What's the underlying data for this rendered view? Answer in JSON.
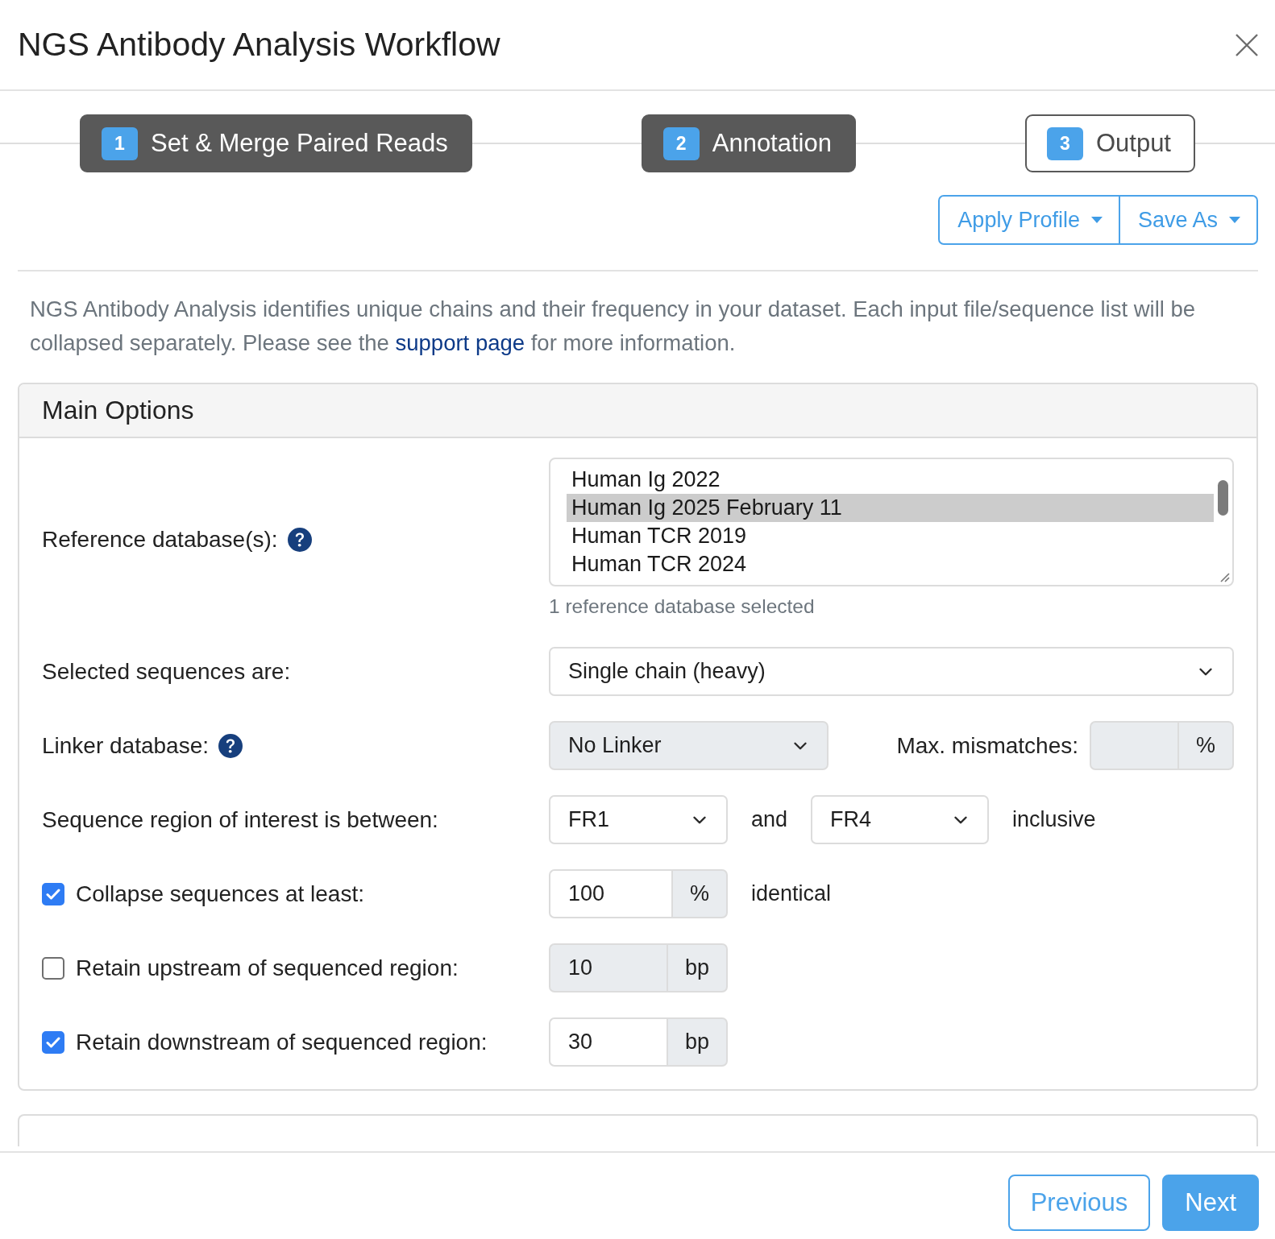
{
  "dialog": {
    "title": "NGS Antibody Analysis Workflow"
  },
  "steps": [
    {
      "number": "1",
      "label": "Set & Merge Paired Reads",
      "visited": true
    },
    {
      "number": "2",
      "label": "Annotation",
      "visited": true
    },
    {
      "number": "3",
      "label": "Output",
      "visited": false
    }
  ],
  "profile_menus": [
    {
      "label": "Apply Profile"
    },
    {
      "label": "Save As"
    }
  ],
  "intro": {
    "text_before": "NGS Antibody Analysis identifies unique chains and their frequency in your dataset. Each input file/sequence list will be collapsed separately. Please see the",
    "link": "support page",
    "text_after": "for more information."
  },
  "main_options": {
    "title": "Main Options",
    "rows": [
      {
        "kind": "listbox",
        "label": "Reference database(s):",
        "help": true,
        "options": [
          {
            "label": "Human Ig 2022",
            "selected": false
          },
          {
            "label": "Human Ig 2025 February 11",
            "selected": true
          },
          {
            "label": "Human TCR 2019",
            "selected": false
          },
          {
            "label": "Human TCR 2024",
            "selected": false
          }
        ],
        "note": "1 reference database selected"
      },
      {
        "kind": "select",
        "label": "Selected sequences are:",
        "select": {
          "value": "Single chain (heavy)",
          "disabled": false
        }
      },
      {
        "kind": "select_with_input",
        "label": "Linker database:",
        "help": true,
        "select": {
          "value": "No Linker",
          "disabled": true
        },
        "input_label": "Max. mismatches:",
        "input": {
          "unit": "%",
          "disabled": true
        }
      },
      {
        "kind": "range",
        "label": "Sequence region of interest is between:",
        "from": {
          "value": "FR1",
          "disabled": false
        },
        "joiner": "and",
        "to": {
          "value": "FR4",
          "disabled": false
        },
        "suffix": "inclusive"
      },
      {
        "kind": "checkbox_input",
        "label": "Collapse sequences at least:",
        "checked": true,
        "input": {
          "value": "100",
          "unit": "%",
          "disabled": false
        },
        "suffix": "identical"
      },
      {
        "kind": "checkbox_input",
        "label": "Retain upstream of sequenced region:",
        "checked": false,
        "input": {
          "value": "10",
          "unit": "bp",
          "disabled": true
        }
      },
      {
        "kind": "checkbox_input",
        "label": "Retain downstream of sequenced region:",
        "checked": true,
        "input": {
          "value": "30",
          "unit": "bp",
          "disabled": false
        }
      }
    ]
  },
  "footer_buttons": [
    {
      "label": "Previous",
      "kind": "secondary"
    },
    {
      "label": "Next",
      "kind": "primary"
    }
  ]
}
